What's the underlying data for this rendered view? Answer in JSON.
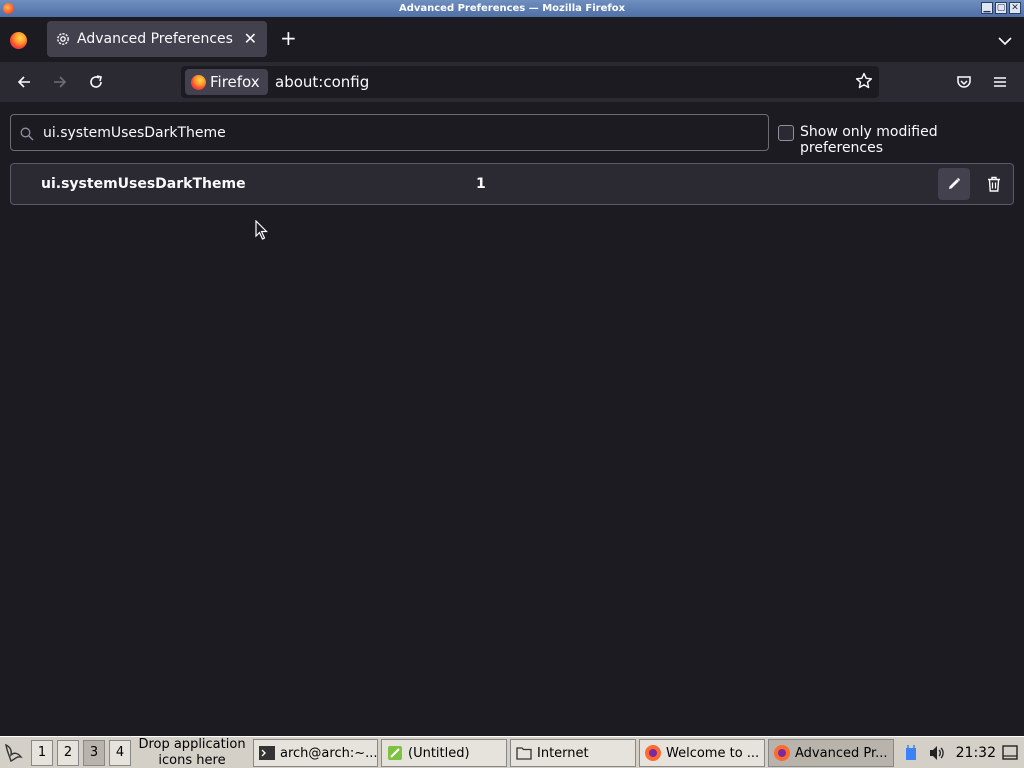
{
  "window": {
    "title": "Advanced Preferences — Mozilla Firefox",
    "buttons": [
      "▁",
      "▢",
      "✕"
    ]
  },
  "tabs": [
    {
      "label": "Advanced Preferences",
      "icon": "gear-icon",
      "active": true
    }
  ],
  "navbar": {
    "identity_label": "Firefox",
    "url": "about:config"
  },
  "config": {
    "search_value": "ui.systemUsesDarkTheme",
    "show_modified_label": "Show only modified preferences",
    "show_modified_checked": false,
    "preferences": [
      {
        "name": "ui.systemUsesDarkTheme",
        "value": "1"
      }
    ]
  },
  "taskbar": {
    "workspaces": [
      "1",
      "2",
      "3",
      "4"
    ],
    "active_workspace": "3",
    "drop_hint": "Drop application icons here",
    "tasks": [
      {
        "label": "arch@arch:~...",
        "icon": "terminal-icon"
      },
      {
        "label": "(Untitled)",
        "icon": "text-editor-icon"
      },
      {
        "label": "Internet",
        "icon": "folder-icon"
      },
      {
        "label": "Welcome to ...",
        "icon": "firefox-icon"
      },
      {
        "label": "Advanced Pr...",
        "icon": "firefox-icon",
        "active": true
      }
    ],
    "clock": "21:32"
  },
  "colors": {
    "content_bg": "#1c1b22",
    "row_bg": "#2b2a33",
    "tab_bg": "#42414d",
    "text": "#fbfbfe"
  }
}
